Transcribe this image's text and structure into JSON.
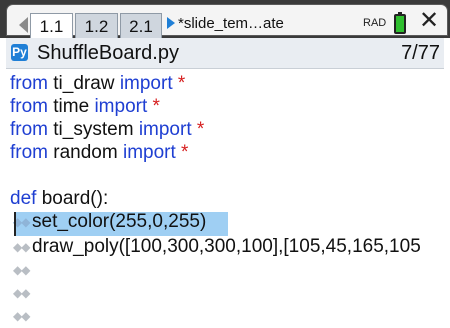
{
  "tabs": [
    {
      "label": "1.1"
    },
    {
      "label": "1.2"
    },
    {
      "label": "2.1"
    }
  ],
  "document": {
    "name": "*slide_tem…ate"
  },
  "status": {
    "angle_mode": "RAD"
  },
  "file": {
    "name": "ShuffleBoard.py",
    "line_count": "7/77"
  },
  "code": [
    {
      "kw": "from",
      "name": " ti_draw ",
      "kw2": "import",
      "star": " *"
    },
    {
      "kw": "from",
      "name": " time ",
      "kw2": "import",
      "star": " *"
    },
    {
      "kw": "from",
      "name": " ti_system ",
      "kw2": "import",
      "star": " *"
    },
    {
      "kw": "from",
      "name": " random ",
      "kw2": "import",
      "star": " *"
    }
  ],
  "def_line": {
    "kw": "def",
    "rest": " board():"
  },
  "body_lines": [
    "set_color(255,0,255)",
    "draw_poly([100,300,300,100],[105,45,165,105"
  ],
  "indent_marker": "◆◆"
}
